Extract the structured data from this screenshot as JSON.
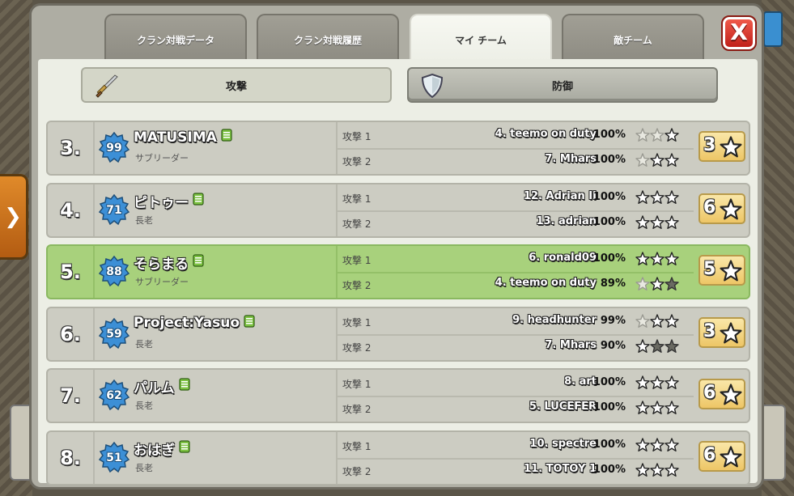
{
  "tabs": [
    {
      "label": "クラン対戦データ",
      "active": false
    },
    {
      "label": "クラン対戦履歴",
      "active": false
    },
    {
      "label": "マイ チーム",
      "active": true
    },
    {
      "label": "敵チーム",
      "active": false
    }
  ],
  "close_label": "X",
  "subtabs": {
    "attack_label": "攻撃",
    "defense_label": "防御",
    "active": "attack"
  },
  "side_arrow": "❯",
  "colors": {
    "highlight_row": "#a8d17c",
    "normal_row": "#ccccc2",
    "level_badge": "#3c8fd6",
    "star_total_bg": "#f3d37f"
  },
  "rows": [
    {
      "rank": "3.",
      "level": "99",
      "name": "MATUSIMA",
      "role": "サブリーダー",
      "highlight": false,
      "total_stars": "3",
      "attacks": [
        {
          "label": "攻撃 1",
          "target": "4. teemo on duty",
          "percent": "100%",
          "stars_earned": 0,
          "stars_new": 1
        },
        {
          "label": "攻撃 2",
          "target": "7. Mhars",
          "percent": "100%",
          "stars_earned": 0,
          "stars_new": 2
        }
      ]
    },
    {
      "rank": "4.",
      "level": "71",
      "name": "ピトゥー",
      "role": "長老",
      "highlight": false,
      "total_stars": "6",
      "attacks": [
        {
          "label": "攻撃 1",
          "target": "12. Adrian II",
          "percent": "100%",
          "stars_earned": 0,
          "stars_new": 3
        },
        {
          "label": "攻撃 2",
          "target": "13. adrian",
          "percent": "100%",
          "stars_earned": 0,
          "stars_new": 3
        }
      ]
    },
    {
      "rank": "5.",
      "level": "88",
      "name": "そらまる",
      "role": "サブリーダー",
      "highlight": true,
      "total_stars": "5",
      "attacks": [
        {
          "label": "攻撃 1",
          "target": "6. ronald09",
          "percent": "100%",
          "stars_earned": 0,
          "stars_new": 3
        },
        {
          "label": "攻撃 2",
          "target": "4. teemo on duty",
          "percent": "89%",
          "stars_earned": 1,
          "stars_new": 1
        }
      ]
    },
    {
      "rank": "6.",
      "level": "59",
      "name": "Project:Yasuo",
      "role": "長老",
      "highlight": false,
      "total_stars": "3",
      "attacks": [
        {
          "label": "攻撃 1",
          "target": "9. headhunter",
          "percent": "99%",
          "stars_earned": 0,
          "stars_new": 2
        },
        {
          "label": "攻撃 2",
          "target": "7. Mhars",
          "percent": "90%",
          "stars_earned": 2,
          "stars_new": 1
        }
      ]
    },
    {
      "rank": "7.",
      "level": "62",
      "name": "パルム",
      "role": "長老",
      "highlight": false,
      "total_stars": "6",
      "attacks": [
        {
          "label": "攻撃 1",
          "target": "8. art",
          "percent": "100%",
          "stars_earned": 0,
          "stars_new": 3
        },
        {
          "label": "攻撃 2",
          "target": "5. LUCEFER",
          "percent": "100%",
          "stars_earned": 0,
          "stars_new": 3
        }
      ]
    },
    {
      "rank": "8.",
      "level": "51",
      "name": "おはぎ",
      "role": "長老",
      "highlight": false,
      "total_stars": "6",
      "attacks": [
        {
          "label": "攻撃 1",
          "target": "10. spectre",
          "percent": "100%",
          "stars_earned": 0,
          "stars_new": 3
        },
        {
          "label": "攻撃 2",
          "target": "11. TOTOY 1",
          "percent": "100%",
          "stars_earned": 0,
          "stars_new": 3
        }
      ]
    }
  ]
}
